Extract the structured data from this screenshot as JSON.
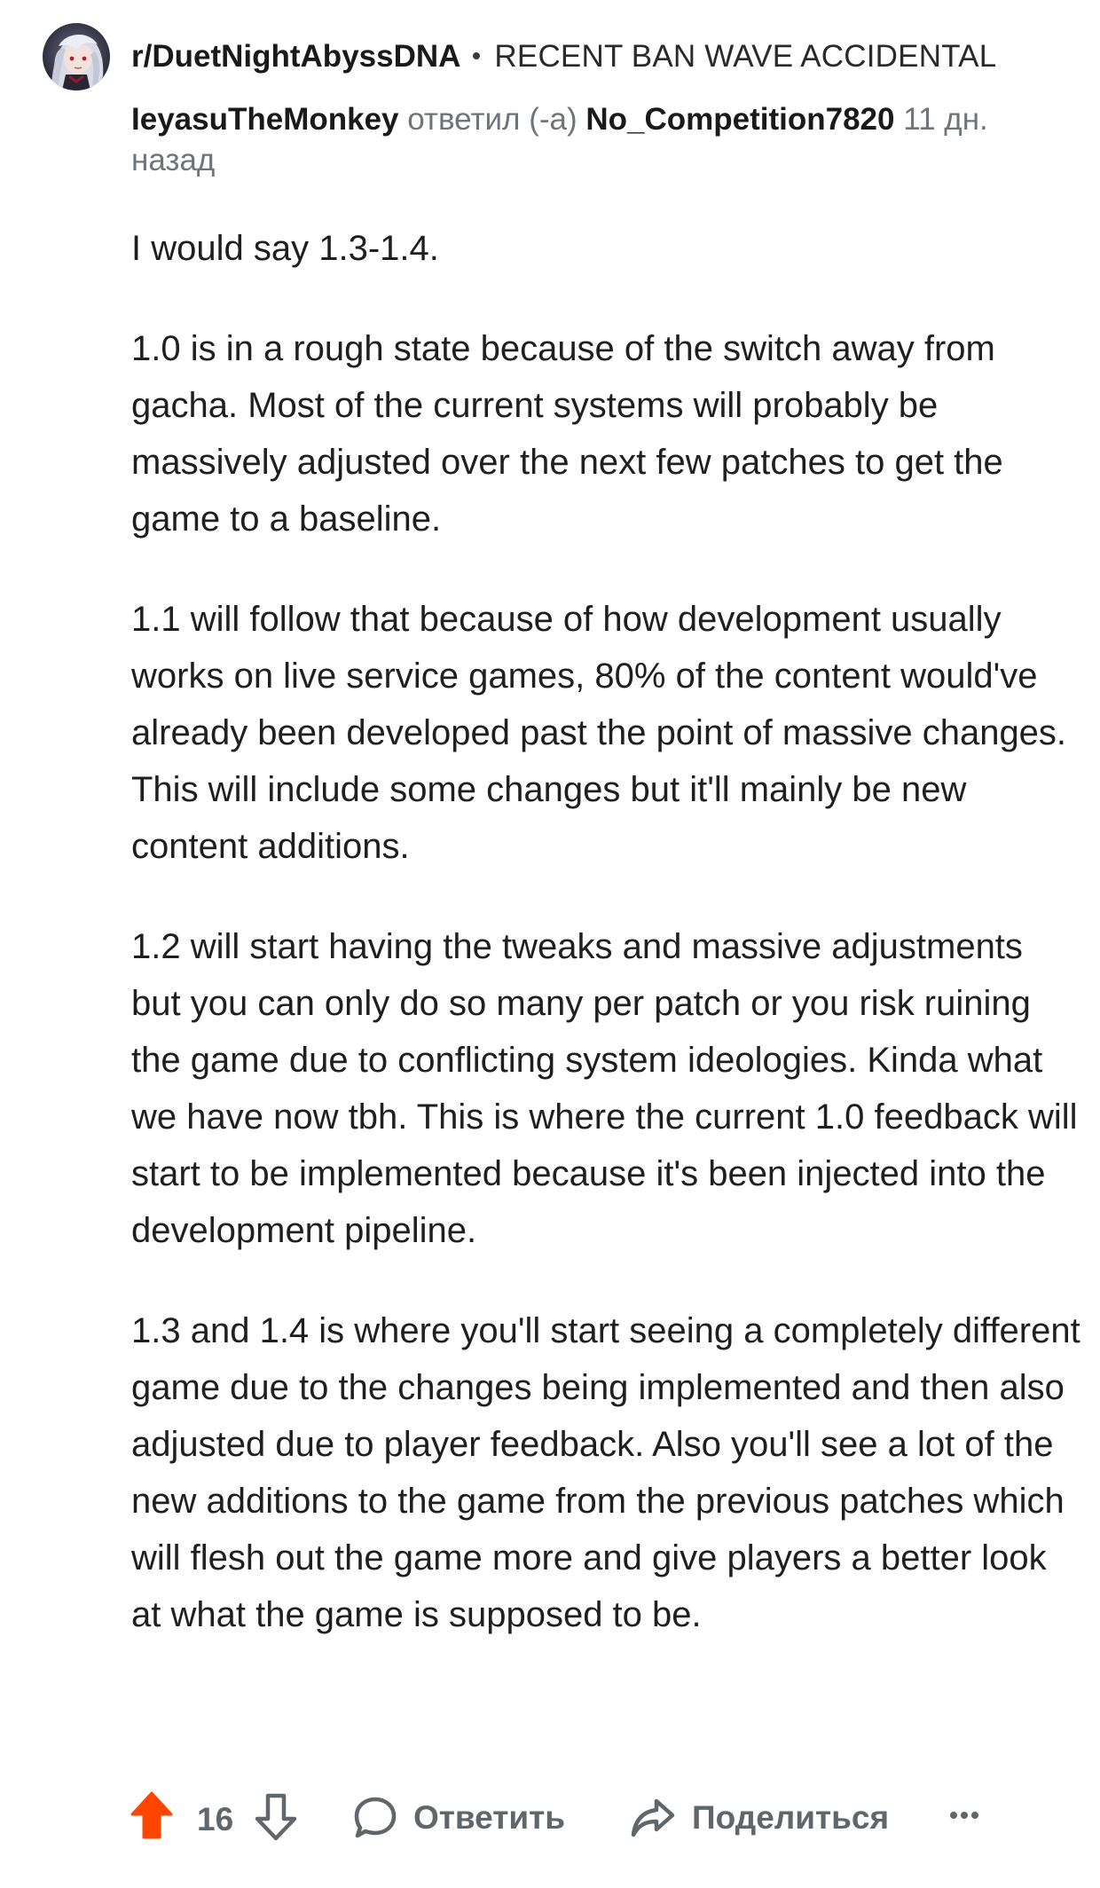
{
  "header": {
    "subreddit": "r/DuetNightAbyssDNA",
    "post_title": "RECENT BAN WAVE ACCIDENTAL",
    "author": "IeyasuTheMonkey",
    "replied_text": "ответил (-а)",
    "replied_to": "No_Competition7820",
    "time_ago": "11 дн. назад"
  },
  "body": {
    "paragraphs": [
      "I would say 1.3-1.4.",
      "1.0 is in a rough state because of the switch away from gacha. Most of the current systems will probably be massively adjusted over the next few patches to get the game to a baseline.",
      "1.1 will follow that because of how development usually works on live service games, 80% of the content would've already been developed past the point of massive changes. This will include some changes but it'll mainly be new content additions.",
      "1.2 will start having the tweaks and massive adjustments but you can only do so many per patch or you risk ruining the game due to conflicting system ideologies. Kinda what we have now tbh. This is where the current 1.0 feedback will start to be implemented because it's been injected into the development pipeline.",
      "1.3 and 1.4 is where you'll start seeing a completely different game due to the changes being implemented and then also adjusted due to player feedback. Also you'll see a lot of the new additions to the game from the previous patches which will flesh out the game more and give players a better look at what the game is supposed to be."
    ]
  },
  "actions": {
    "vote_count": "16",
    "reply_label": "Ответить",
    "share_label": "Поделиться"
  },
  "icons": {
    "upvote": "upvote-arrow-icon",
    "downvote": "downvote-arrow-icon",
    "reply": "speech-bubble-icon",
    "share": "share-arrow-icon",
    "more": "more-dots-icon"
  },
  "colors": {
    "upvote_active": "#ff4500",
    "muted": "#6e7479",
    "text": "#1a1a1b"
  }
}
